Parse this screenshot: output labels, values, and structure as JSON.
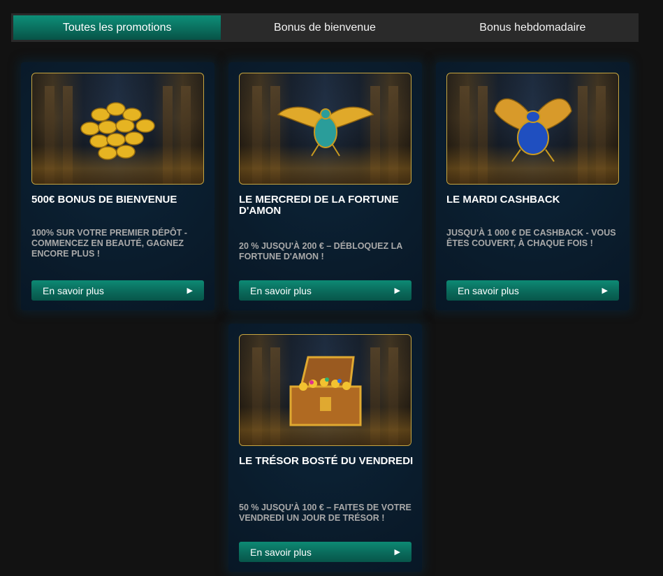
{
  "tabs": [
    {
      "label": "Toutes les promotions",
      "active": true
    },
    {
      "label": "Bonus de bienvenue",
      "active": false
    },
    {
      "label": "Bonus hebdomadaire",
      "active": false
    }
  ],
  "cards": [
    {
      "title": "500€ BONUS DE BIENVENUE",
      "description": "100% SUR VOTRE PREMIER DÉPÔT - COMMENCEZ EN BEAUTÉ, GAGNEZ ENCORE PLUS !",
      "button": "En savoir plus",
      "image": "gold-coins"
    },
    {
      "title": "LE MERCREDI DE LA FORTUNE D'AMON",
      "description": "20 % JUSQU'À 200 € – DÉBLOQUEZ LA FORTUNE D'AMON !",
      "button": "En savoir plus",
      "image": "golden-scarab"
    },
    {
      "title": "LE MARDI CASHBACK",
      "description": "JUSQU'À 1 000 € DE CASHBACK - VOUS ÊTES COUVERT, À CHAQUE FOIS !",
      "button": "En savoir plus",
      "image": "blue-scarab"
    },
    {
      "title": "LE TRÉSOR BOSTÉ DU VENDREDI",
      "description": "50 % JUSQU'À 100 € – FAITES DE VOTRE VENDREDI UN JOUR DE TRÉSOR !",
      "button": "En savoir plus",
      "image": "treasure-chest"
    }
  ],
  "colors": {
    "accent": "#0a6b5b",
    "background": "#121212",
    "card": "#0a1c2c",
    "frame": "#c8a640"
  }
}
